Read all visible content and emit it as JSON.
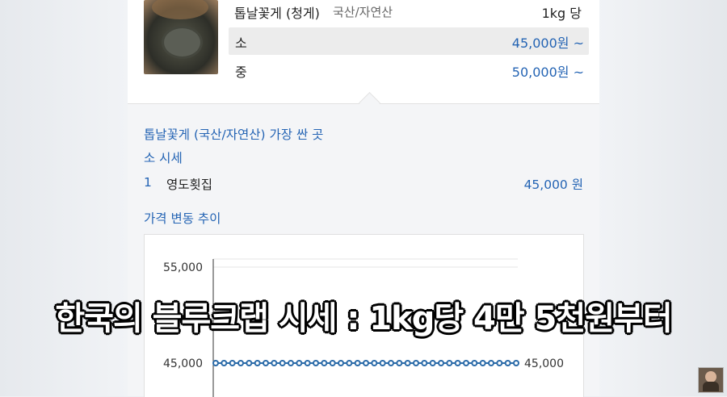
{
  "product": {
    "name": "톱날꽃게 (청게)",
    "origin": "국산/자연산",
    "unit": "1kg 당"
  },
  "sizes": [
    {
      "label": "소",
      "price": "45,000원 ~",
      "selected": true
    },
    {
      "label": "중",
      "price": "50,000원 ~",
      "selected": false
    }
  ],
  "cheapest": {
    "title": "톱날꽃게 (국산/자연산) 가장 싼 곳",
    "subtitle": "소 시세",
    "rank": "1",
    "shop": "영도횟집",
    "price": "45,000 원"
  },
  "trend": {
    "title": "가격 변동 추이"
  },
  "chart_data": {
    "type": "line",
    "y_ticks": [
      "55,000",
      "45,000"
    ],
    "end_label": "45,000",
    "values": [
      45000,
      45000,
      45000,
      45000,
      45000,
      45000,
      45000,
      45000,
      45000,
      45000,
      45000,
      45000,
      45000,
      45000,
      45000,
      45000,
      45000,
      45000,
      45000,
      45000,
      45000,
      45000,
      45000,
      45000,
      45000,
      45000,
      45000,
      45000,
      45000,
      45000,
      45000,
      45000,
      45000,
      45000,
      45000,
      45000,
      45000
    ],
    "ylim": [
      45000,
      55000
    ],
    "series_color": "#2a6aa8"
  },
  "caption": "한국의 블루크랩 시세 : 1kg당 4만 5천원부터"
}
